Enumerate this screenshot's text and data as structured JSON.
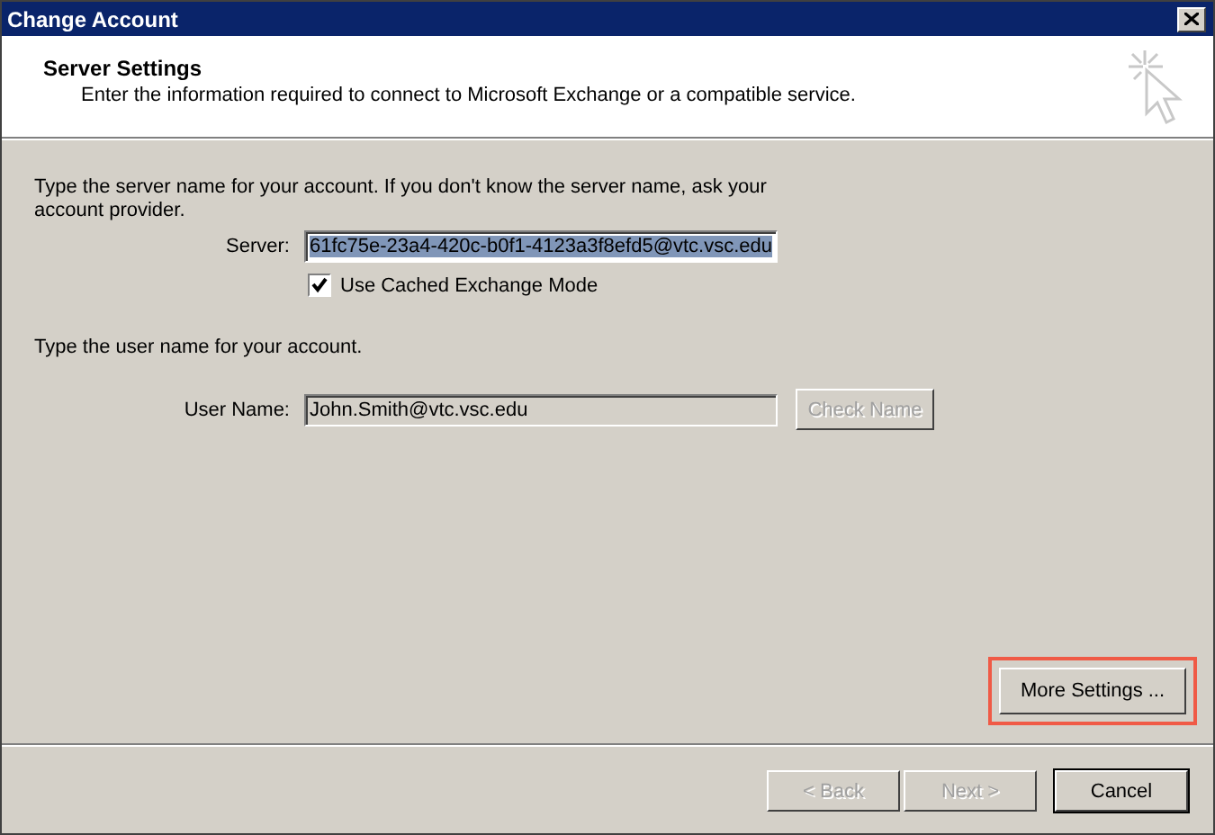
{
  "window": {
    "title": "Change Account"
  },
  "header": {
    "title": "Server Settings",
    "subtitle": "Enter the information required to connect to Microsoft Exchange or a compatible service."
  },
  "server": {
    "instruction": "Type the server name for your account. If you don't know the server name, ask your account provider.",
    "label": "Server:",
    "value": "61fc75e-23a4-420c-b0f1-4123a3f8efd5@vtc.vsc.edu",
    "selected": true,
    "cached_mode": {
      "label": "Use Cached Exchange Mode",
      "checked": true
    }
  },
  "user": {
    "instruction": "Type the user name for your account.",
    "label": "User Name:",
    "value": "John.Smith@vtc.vsc.edu",
    "disabled": true,
    "check_button": {
      "label": "Check Name",
      "disabled": true
    }
  },
  "more_settings": {
    "label": "More Settings ...",
    "highlighted": true
  },
  "buttons": [
    {
      "label": "< Back",
      "disabled": true,
      "default": false
    },
    {
      "label": "Next >",
      "disabled": true,
      "default": false
    },
    {
      "label": "Cancel",
      "disabled": false,
      "default": true
    }
  ]
}
